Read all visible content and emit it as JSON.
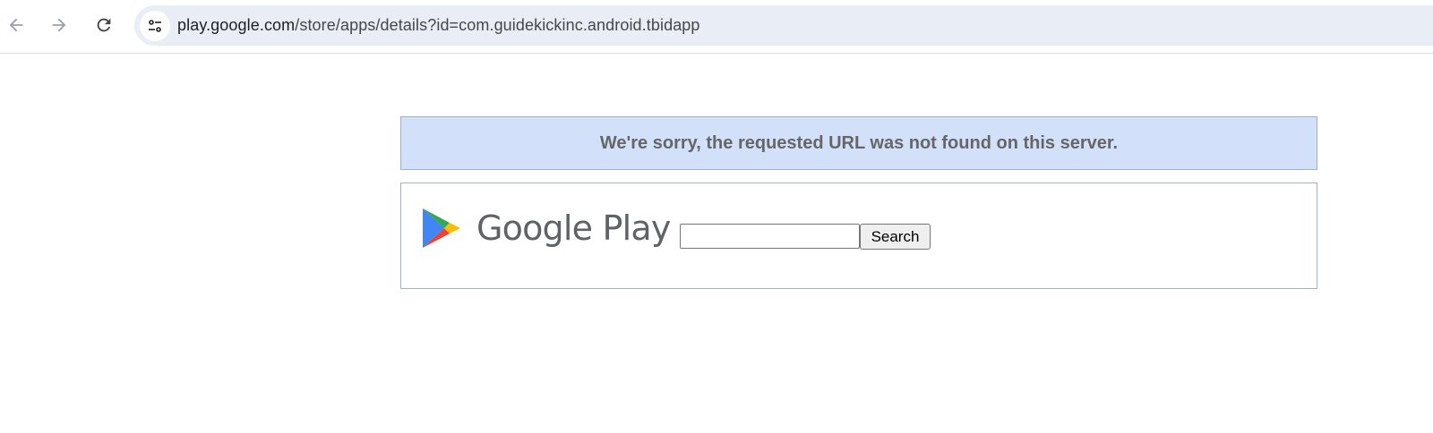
{
  "browser": {
    "back_icon": "arrow-left-icon",
    "forward_icon": "arrow-right-icon",
    "reload_icon": "reload-icon",
    "site_info_icon": "tune-icon",
    "url_host": "play.google.com",
    "url_path": "/store/apps/details?id=com.guidekickinc.android.tbidapp"
  },
  "page": {
    "error_message": "We're sorry, the requested URL was not found on this server.",
    "logo_text": "Google Play",
    "search_value": "",
    "search_button_label": "Search"
  },
  "colors": {
    "banner_background": "#d2e1f9",
    "panel_border": "#9cb1ca",
    "error_text": "#666666",
    "omnibox_background": "#e9eef6"
  }
}
